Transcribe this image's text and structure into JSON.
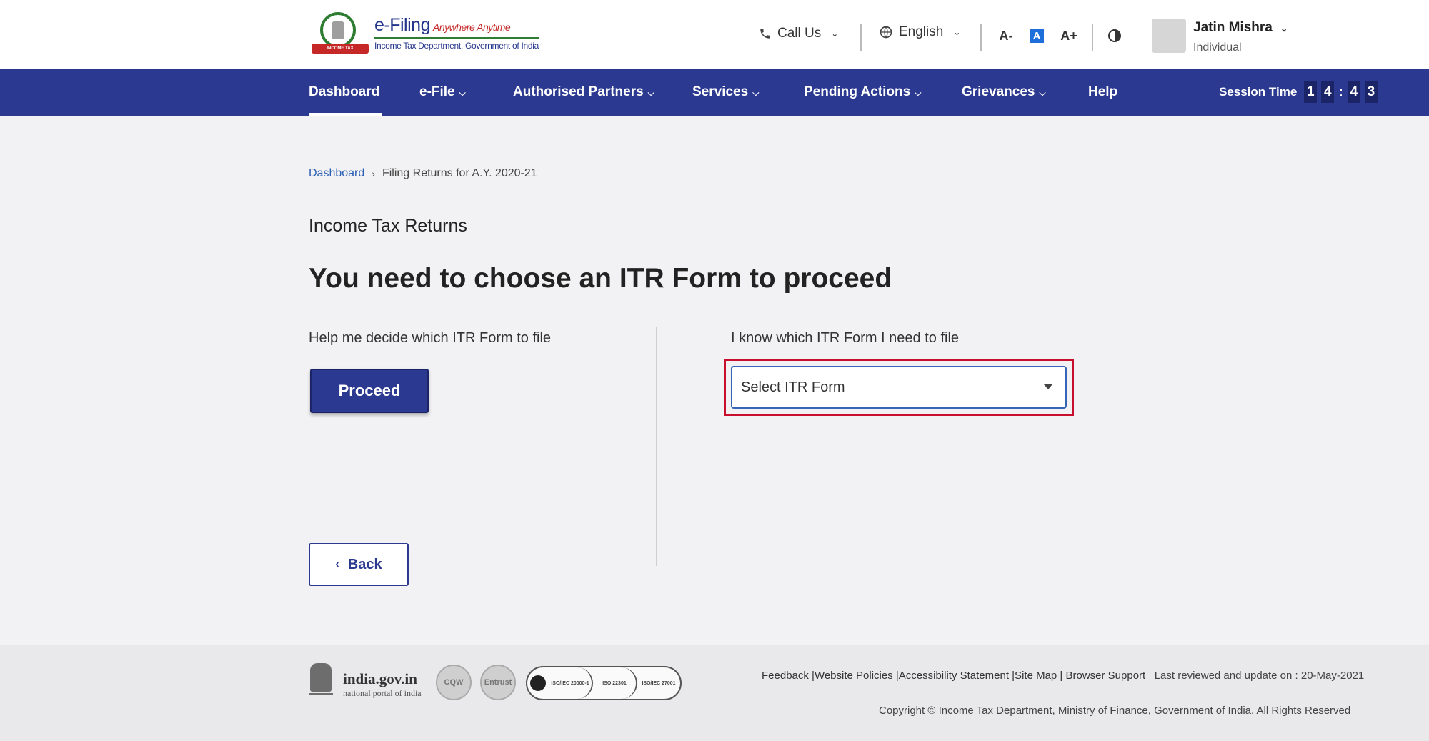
{
  "header": {
    "brand_title": "e-Filing",
    "brand_tagline": "Anywhere Anytime",
    "brand_subtitle": "Income Tax Department, Government of India",
    "emblem_text": "INCOME TAX DEPARTMENT",
    "call_us": "Call Us",
    "language": "English",
    "font_decrease": "A-",
    "font_reset": "A",
    "font_increase": "A+",
    "user_name": "Jatin Mishra",
    "user_role": "Individual"
  },
  "nav": {
    "items": [
      {
        "label": "Dashboard",
        "caret": false
      },
      {
        "label": "e-File",
        "caret": true
      },
      {
        "label": "Authorised Partners",
        "caret": true
      },
      {
        "label": "Services",
        "caret": true
      },
      {
        "label": "Pending Actions",
        "caret": true
      },
      {
        "label": "Grievances",
        "caret": true
      },
      {
        "label": "Help",
        "caret": false
      }
    ],
    "session_label": "Session Time",
    "session_digits": [
      "1",
      "4",
      "4",
      "3"
    ]
  },
  "breadcrumb": {
    "home": "Dashboard",
    "current": "Filing Returns for A.Y. 2020-21"
  },
  "main": {
    "section_title": "Income Tax Returns",
    "heading": "You need to choose an ITR Form to proceed",
    "left_label": "Help me decide which ITR Form to file",
    "proceed_label": "Proceed",
    "right_label": "I know which ITR Form I need to file",
    "select_value": "Select ITR Form",
    "back_label": "Back",
    "highlight_color": "#c8102e"
  },
  "footer": {
    "portal_name": "india.gov.in",
    "portal_sub": "national portal of india",
    "cqw_badge": "CQW",
    "entrust_badge": "Entrust",
    "iso_badges": [
      "ISO/IEC 20000-1",
      "ISO 22301",
      "ISO/IEC 27001"
    ],
    "links_text": "Feedback |Website Policies |Accessibility Statement |Site Map | Browser Support",
    "last_reviewed": "Last reviewed and update on : 20-May-2021",
    "copyright": "Copyright © Income Tax Department, Ministry of Finance, Government of India. All Rights Reserved"
  },
  "colors": {
    "nav_bg": "#2b3990",
    "link": "#2b5fb4",
    "accent": "#1e6fd9"
  }
}
